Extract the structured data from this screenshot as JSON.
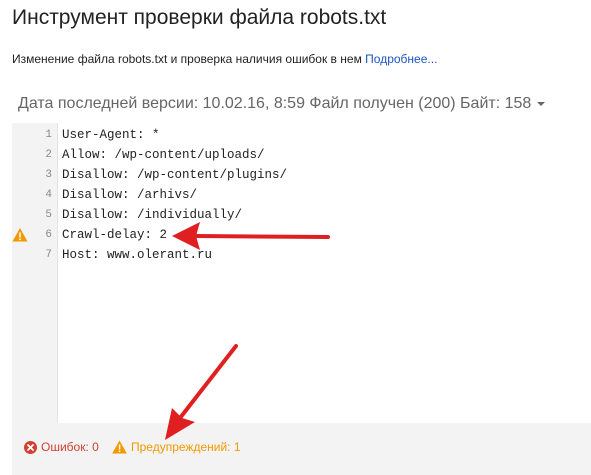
{
  "header": {
    "title": "Инструмент проверки файла robots.txt",
    "subtitle": "Изменение файла robots.txt и проверка наличия ошибок в нем",
    "more_link": "Подробнее..."
  },
  "version_selector": {
    "text": "Дата последней версии: 10.02.16, 8:59 Файл получен (200) Байт: 158"
  },
  "editor": {
    "lines": [
      {
        "number": "1",
        "text": "User-Agent: *"
      },
      {
        "number": "2",
        "text": "Allow: /wp-content/uploads/"
      },
      {
        "number": "3",
        "text": "Disallow: /wp-content/plugins/"
      },
      {
        "number": "4",
        "text": "Disallow: /arhivs/"
      },
      {
        "number": "5",
        "text": "Disallow: /individually/"
      },
      {
        "number": "6",
        "text": "Crawl-delay: 2",
        "warning": true
      },
      {
        "number": "7",
        "text": "Host: www.olerant.ru"
      }
    ]
  },
  "status": {
    "errors": "Ошибок: 0",
    "warnings": "Предупреждений: 1"
  },
  "colors": {
    "error": "#d23f31",
    "warning": "#f29900",
    "link": "#1a55c0",
    "annotation_arrow": "#e02020"
  }
}
